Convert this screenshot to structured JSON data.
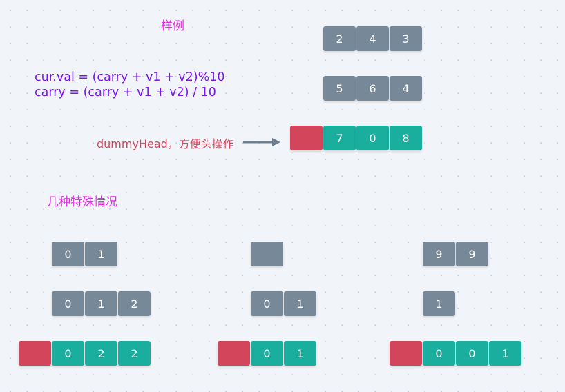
{
  "labels": {
    "example": "样例",
    "special_cases": "几种特殊情况",
    "formula_line1": "cur.val = (carry + v1 + v2)%10",
    "formula_line2": "carry = (carry + v1 + v2) / 10",
    "dummy_head": "dummyHead，方便头操作"
  },
  "colors": {
    "input": "#778899",
    "result": "#1aae9f",
    "dummy": "#d3455b"
  },
  "lists": {
    "example_l1": [
      "2",
      "4",
      "3"
    ],
    "example_l2": [
      "5",
      "6",
      "4"
    ],
    "example_result": [
      "7",
      "0",
      "8"
    ],
    "case1_l1": [
      "0",
      "1"
    ],
    "case1_l2": [
      "0",
      "1",
      "2"
    ],
    "case1_result": [
      "0",
      "2",
      "2"
    ],
    "case2_l1": [
      ""
    ],
    "case2_l2": [
      "0",
      "1"
    ],
    "case2_result": [
      "0",
      "1"
    ],
    "case3_l1": [
      "9",
      "9"
    ],
    "case3_l2": [
      "1"
    ],
    "case3_result": [
      "0",
      "0",
      "1"
    ]
  }
}
